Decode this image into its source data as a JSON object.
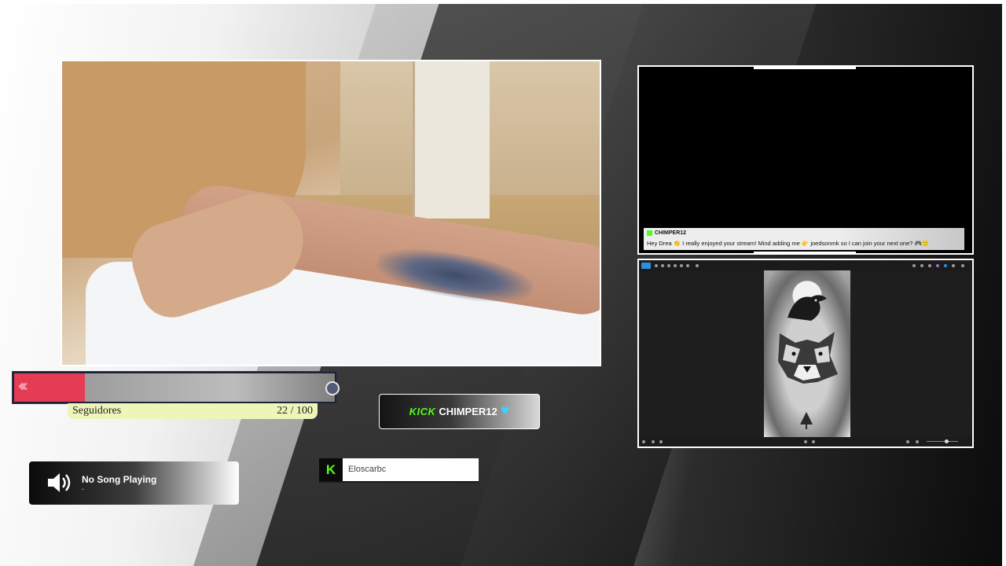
{
  "followers_goal": {
    "label": "Seguidores",
    "count": "22 / 100",
    "current": 22,
    "target": 100,
    "fill_color": "#e63b55"
  },
  "kick_channel": {
    "brand": "KICK",
    "name": "CHIMPER12",
    "icon": "heart-icon",
    "brand_color": "#53fc18"
  },
  "now_playing": {
    "title": "No Song Playing",
    "subtitle": "-",
    "icon": "speaker-icon"
  },
  "latest_follower": {
    "platform_icon": "kick-logo-icon",
    "logo_letter": "K",
    "name": "Eloscarbc"
  },
  "chat": {
    "messages": [
      {
        "user": "CHIMPER12",
        "text": "Hey Drea 👏 I really enjoyed your stream! Mind adding me 👉 joedsonmk so I can join your next one? 🎮🙂"
      }
    ]
  },
  "image_viewer": {
    "subject": "wolf-and-crow-tattoo-design"
  }
}
